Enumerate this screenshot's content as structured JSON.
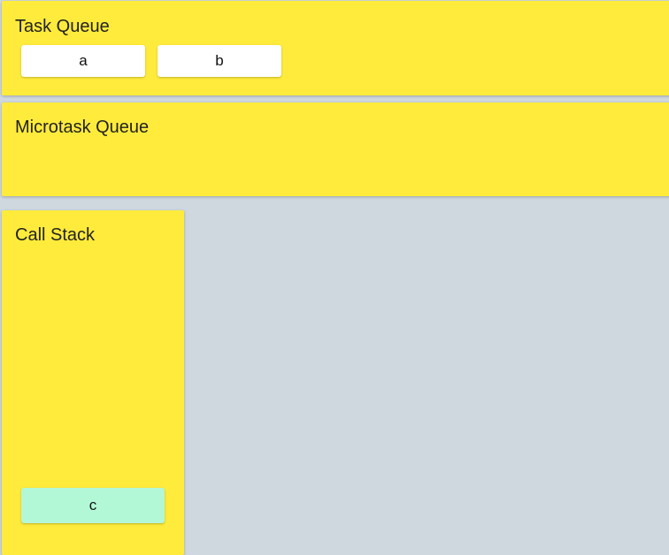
{
  "task_queue": {
    "title": "Task Queue",
    "items": [
      {
        "label": "a"
      },
      {
        "label": "b"
      }
    ]
  },
  "microtask_queue": {
    "title": "Microtask Queue",
    "items": []
  },
  "call_stack": {
    "title": "Call Stack",
    "items": [
      {
        "label": "c"
      }
    ]
  },
  "colors": {
    "background": "#cfd8df",
    "panel": "#ffeb3b",
    "task_card": "#ffffff",
    "stack_frame": "#b2f8d6"
  }
}
